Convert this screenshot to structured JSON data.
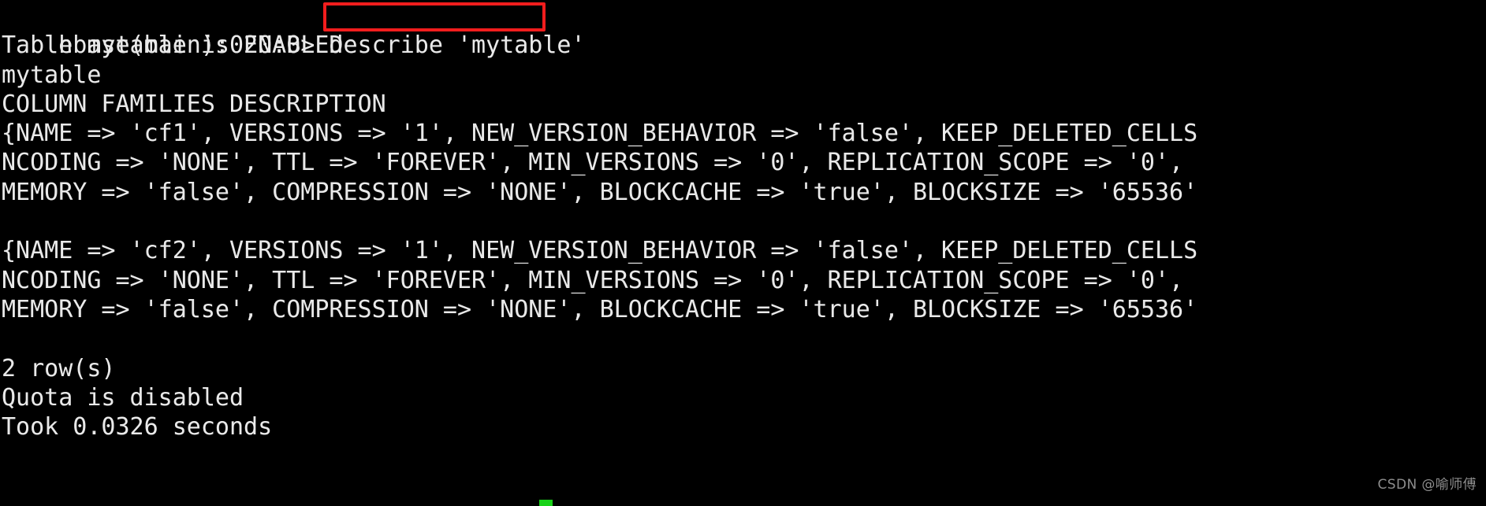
{
  "terminal": {
    "app": "hbase-shell",
    "background_color": "#000000",
    "foreground_color": "#e9e9e9",
    "highlight_color": "#f21d1d",
    "cursor_color": "#19d219",
    "prompt": "hbase(main):020:0> ",
    "command": "describe 'mytable'",
    "lines": [
      "hbase(main):020:0> describe 'mytable'",
      "Table mytable is ENABLED",
      "mytable",
      "COLUMN FAMILIES DESCRIPTION",
      "{NAME => 'cf1', VERSIONS => '1', NEW_VERSION_BEHAVIOR => 'false', KEEP_DELETED_CELLS",
      "NCODING => 'NONE', TTL => 'FOREVER', MIN_VERSIONS => '0', REPLICATION_SCOPE => '0',",
      "MEMORY => 'false', COMPRESSION => 'NONE', BLOCKCACHE => 'true', BLOCKSIZE => '65536'",
      "",
      "{NAME => 'cf2', VERSIONS => '1', NEW_VERSION_BEHAVIOR => 'false', KEEP_DELETED_CELLS",
      "NCODING => 'NONE', TTL => 'FOREVER', MIN_VERSIONS => '0', REPLICATION_SCOPE => '0',",
      "MEMORY => 'false', COMPRESSION => 'NONE', BLOCKCACHE => 'true', BLOCKSIZE => '65536'",
      "",
      "2 row(s)",
      "Quota is disabled",
      "Took 0.0326 seconds"
    ]
  },
  "watermark": {
    "text": "CSDN @喻师傅"
  }
}
